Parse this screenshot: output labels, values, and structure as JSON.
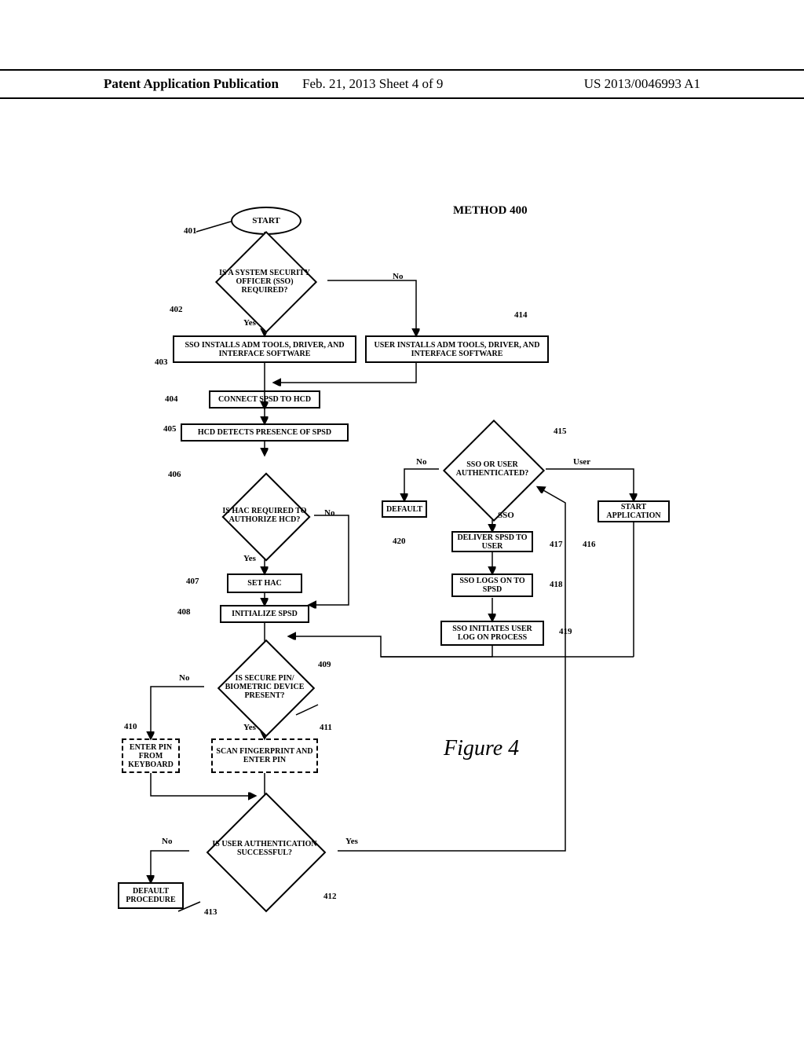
{
  "header": {
    "left": "Patent Application Publication",
    "center": "Feb. 21, 2013  Sheet 4 of 9",
    "right": "US 2013/0046993 A1"
  },
  "title": "METHOD 400",
  "figure": "Figure 4",
  "n": {
    "start": "START",
    "d402": "IS A SYSTEM SECURITY OFFICER (SSO) REQUIRED?",
    "b403": "SSO INSTALLS ADM TOOLS, DRIVER, AND INTERFACE SOFTWARE",
    "b414": "USER INSTALLS ADM TOOLS, DRIVER, AND INTERFACE SOFTWARE",
    "b404": "CONNECT SPSD TO HCD",
    "b405": "HCD DETECTS PRESENCE OF SPSD",
    "d406": "IS HAC REQUIRED TO AUTHORIZE HCD?",
    "b407": "SET HAC",
    "b408": "INITIALIZE SPSD",
    "d409": "IS SECURE PIN/ BIOMETRIC DEVICE PRESENT?",
    "b410": "ENTER PIN FROM KEYBOARD",
    "b411": "SCAN FINGERPRINT AND ENTER PIN",
    "d412": "IS USER AUTHENTICATION SUCCESSFUL?",
    "b413": "DEFAULT PROCEDURE",
    "d415": "SSO OR USER AUTHENTICATED?",
    "b416": "START APPLICATION",
    "b417": "DELIVER SPSD TO USER",
    "b418": "SSO LOGS ON TO SPSD",
    "b419": "SSO INITIATES USER LOG ON PROCESS",
    "b420": "DEFAULT"
  },
  "e": {
    "yes": "Yes",
    "no": "No",
    "sso": "SSO",
    "user": "User"
  },
  "r": {
    "401": "401",
    "402": "402",
    "403": "403",
    "404": "404",
    "405": "405",
    "406": "406",
    "407": "407",
    "408": "408",
    "409": "409",
    "410": "410",
    "411": "411",
    "412": "412",
    "413": "413",
    "414": "414",
    "415": "415",
    "416": "416",
    "417": "417",
    "418": "418",
    "419": "419",
    "420": "420"
  }
}
